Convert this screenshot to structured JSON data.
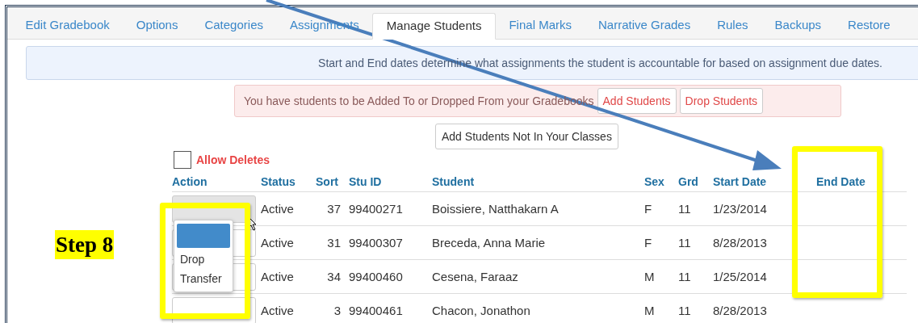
{
  "tabs": [
    {
      "label": "Edit Gradebook",
      "selected": false
    },
    {
      "label": "Options",
      "selected": false
    },
    {
      "label": "Categories",
      "selected": false
    },
    {
      "label": "Assignments",
      "selected": false
    },
    {
      "label": "Manage Students",
      "selected": true
    },
    {
      "label": "Final Marks",
      "selected": false
    },
    {
      "label": "Narrative Grades",
      "selected": false
    },
    {
      "label": "Rules",
      "selected": false
    },
    {
      "label": "Backups",
      "selected": false
    },
    {
      "label": "Restore",
      "selected": false
    }
  ],
  "info": "Start and End dates determine what assignments the student is accountable for based on assignment due dates.",
  "alert": {
    "text": "You have students to be Added To or Dropped From your Gradebooks",
    "buttons": [
      "Add Students",
      "Drop Students"
    ]
  },
  "add_button": "Add Students Not In Your Classes",
  "allow_deletes": {
    "label": "Allow Deletes",
    "checked": false
  },
  "columns": [
    "Action",
    "Status",
    "Sort",
    "Stu ID",
    "Student",
    "Sex",
    "Grd",
    "Start Date",
    "End Date"
  ],
  "rows": [
    {
      "focused": true,
      "status": "Active",
      "sort": "37",
      "stu_id": "99400271",
      "student": "Boissiere, Natthakarn A",
      "sex": "F",
      "grd": "11",
      "start_date": "1/23/2014"
    },
    {
      "focused": false,
      "status": "Active",
      "sort": "31",
      "stu_id": "99400307",
      "student": "Breceda, Anna Marie",
      "sex": "F",
      "grd": "11",
      "start_date": "8/28/2013"
    },
    {
      "focused": false,
      "status": "Active",
      "sort": "34",
      "stu_id": "99400460",
      "student": "Cesena, Faraaz",
      "sex": "M",
      "grd": "11",
      "start_date": "1/25/2014"
    },
    {
      "focused": false,
      "status": "Active",
      "sort": "3",
      "stu_id": "99400461",
      "student": "Chacon, Jonathon",
      "sex": "M",
      "grd": "11",
      "start_date": "8/28/2013"
    }
  ],
  "action_menu": {
    "blank_option_highlighted": true,
    "options": [
      {
        "label": "Drop",
        "selected": false
      },
      {
        "label": "Transfer",
        "selected": false
      }
    ]
  },
  "step_label": "Step 8"
}
